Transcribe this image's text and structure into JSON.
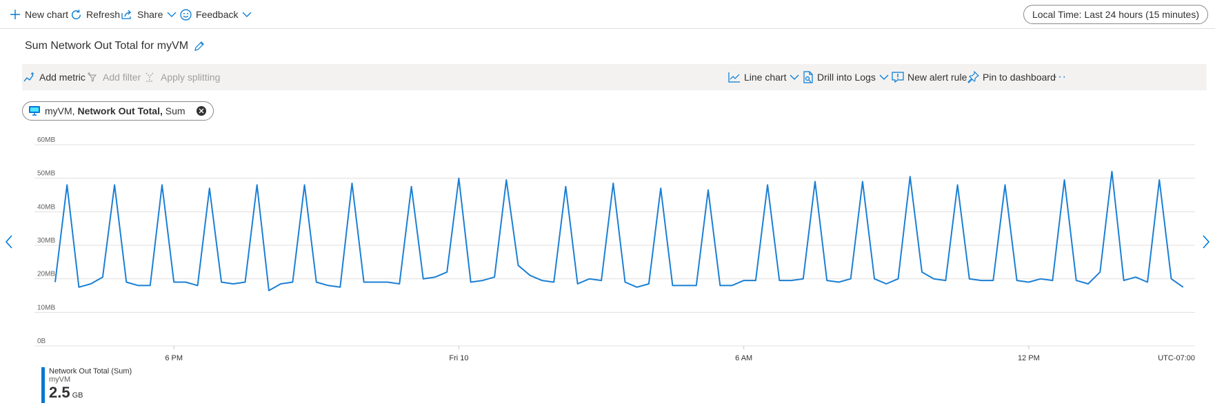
{
  "toolbar_top": {
    "new_chart": "New chart",
    "refresh": "Refresh",
    "share": "Share",
    "feedback": "Feedback",
    "time_range": "Local Time: Last 24 hours (15 minutes)"
  },
  "chart_title": "Sum Network Out Total for myVM",
  "metrics_toolbar": {
    "add_metric": "Add metric",
    "add_filter": "Add filter",
    "apply_splitting": "Apply splitting",
    "line_chart": "Line chart",
    "drill_into_logs": "Drill into Logs",
    "new_alert_rule": "New alert rule",
    "pin_to_dashboard": "Pin to dashboard",
    "more": "···"
  },
  "metric_pill": {
    "resource": "myVM,",
    "metric": "Network Out Total,",
    "aggregation": "Sum"
  },
  "colors": {
    "accent": "#0078d4",
    "line": "#1a7fd4",
    "grid": "#e1dfdd"
  },
  "legend": {
    "series": "Network Out Total (Sum)",
    "resource": "myVM",
    "value": "2.5",
    "unit": "GB"
  },
  "chart_data": {
    "type": "line",
    "ylabel": "",
    "xlabel": "",
    "ylim": [
      0,
      60
    ],
    "y_ticks": [
      {
        "value": 60,
        "label": "60MB"
      },
      {
        "value": 50,
        "label": "50MB"
      },
      {
        "value": 40,
        "label": "40MB"
      },
      {
        "value": 30,
        "label": "30MB"
      },
      {
        "value": 20,
        "label": "20MB"
      },
      {
        "value": 10,
        "label": "10MB"
      },
      {
        "value": 0,
        "label": "0B"
      }
    ],
    "x_ticks": [
      {
        "hours": 2,
        "label": "6 PM"
      },
      {
        "hours": 8,
        "label": "Fri 10"
      },
      {
        "hours": 14,
        "label": "6 AM"
      },
      {
        "hours": 20,
        "label": "12 PM"
      }
    ],
    "x_range_hours": [
      -0.5,
      23.5
    ],
    "timezone_label": "UTC-07:00",
    "grid": true,
    "series": [
      {
        "name": "Network Out Total (Sum)",
        "interval_hours": 0.25,
        "start_hours": -0.5,
        "values": [
          19,
          48,
          17.5,
          18.5,
          20.5,
          48,
          19,
          18,
          18,
          48,
          19,
          19,
          18,
          47,
          19,
          18.5,
          19,
          48,
          16.5,
          18.5,
          19,
          48,
          19,
          18,
          17.5,
          48.5,
          19,
          19,
          19,
          18.5,
          47.5,
          20,
          20.5,
          22,
          50,
          19,
          19.5,
          20.5,
          49.5,
          24,
          21,
          19.5,
          19,
          47.5,
          18.5,
          20,
          19.5,
          48.5,
          19,
          17.5,
          18.5,
          47,
          18,
          18,
          18,
          46.5,
          18,
          18,
          19.5,
          19.5,
          48,
          19.5,
          19.5,
          20,
          49,
          19.5,
          19,
          20,
          49,
          20,
          18.5,
          20,
          50.5,
          22,
          20,
          19.5,
          48,
          20,
          19.5,
          19.5,
          48,
          19.5,
          19,
          20,
          19.5,
          49.5,
          19.5,
          18.5,
          22,
          52,
          19.5,
          20.5,
          19,
          49.5,
          20,
          17.5
        ]
      }
    ]
  }
}
